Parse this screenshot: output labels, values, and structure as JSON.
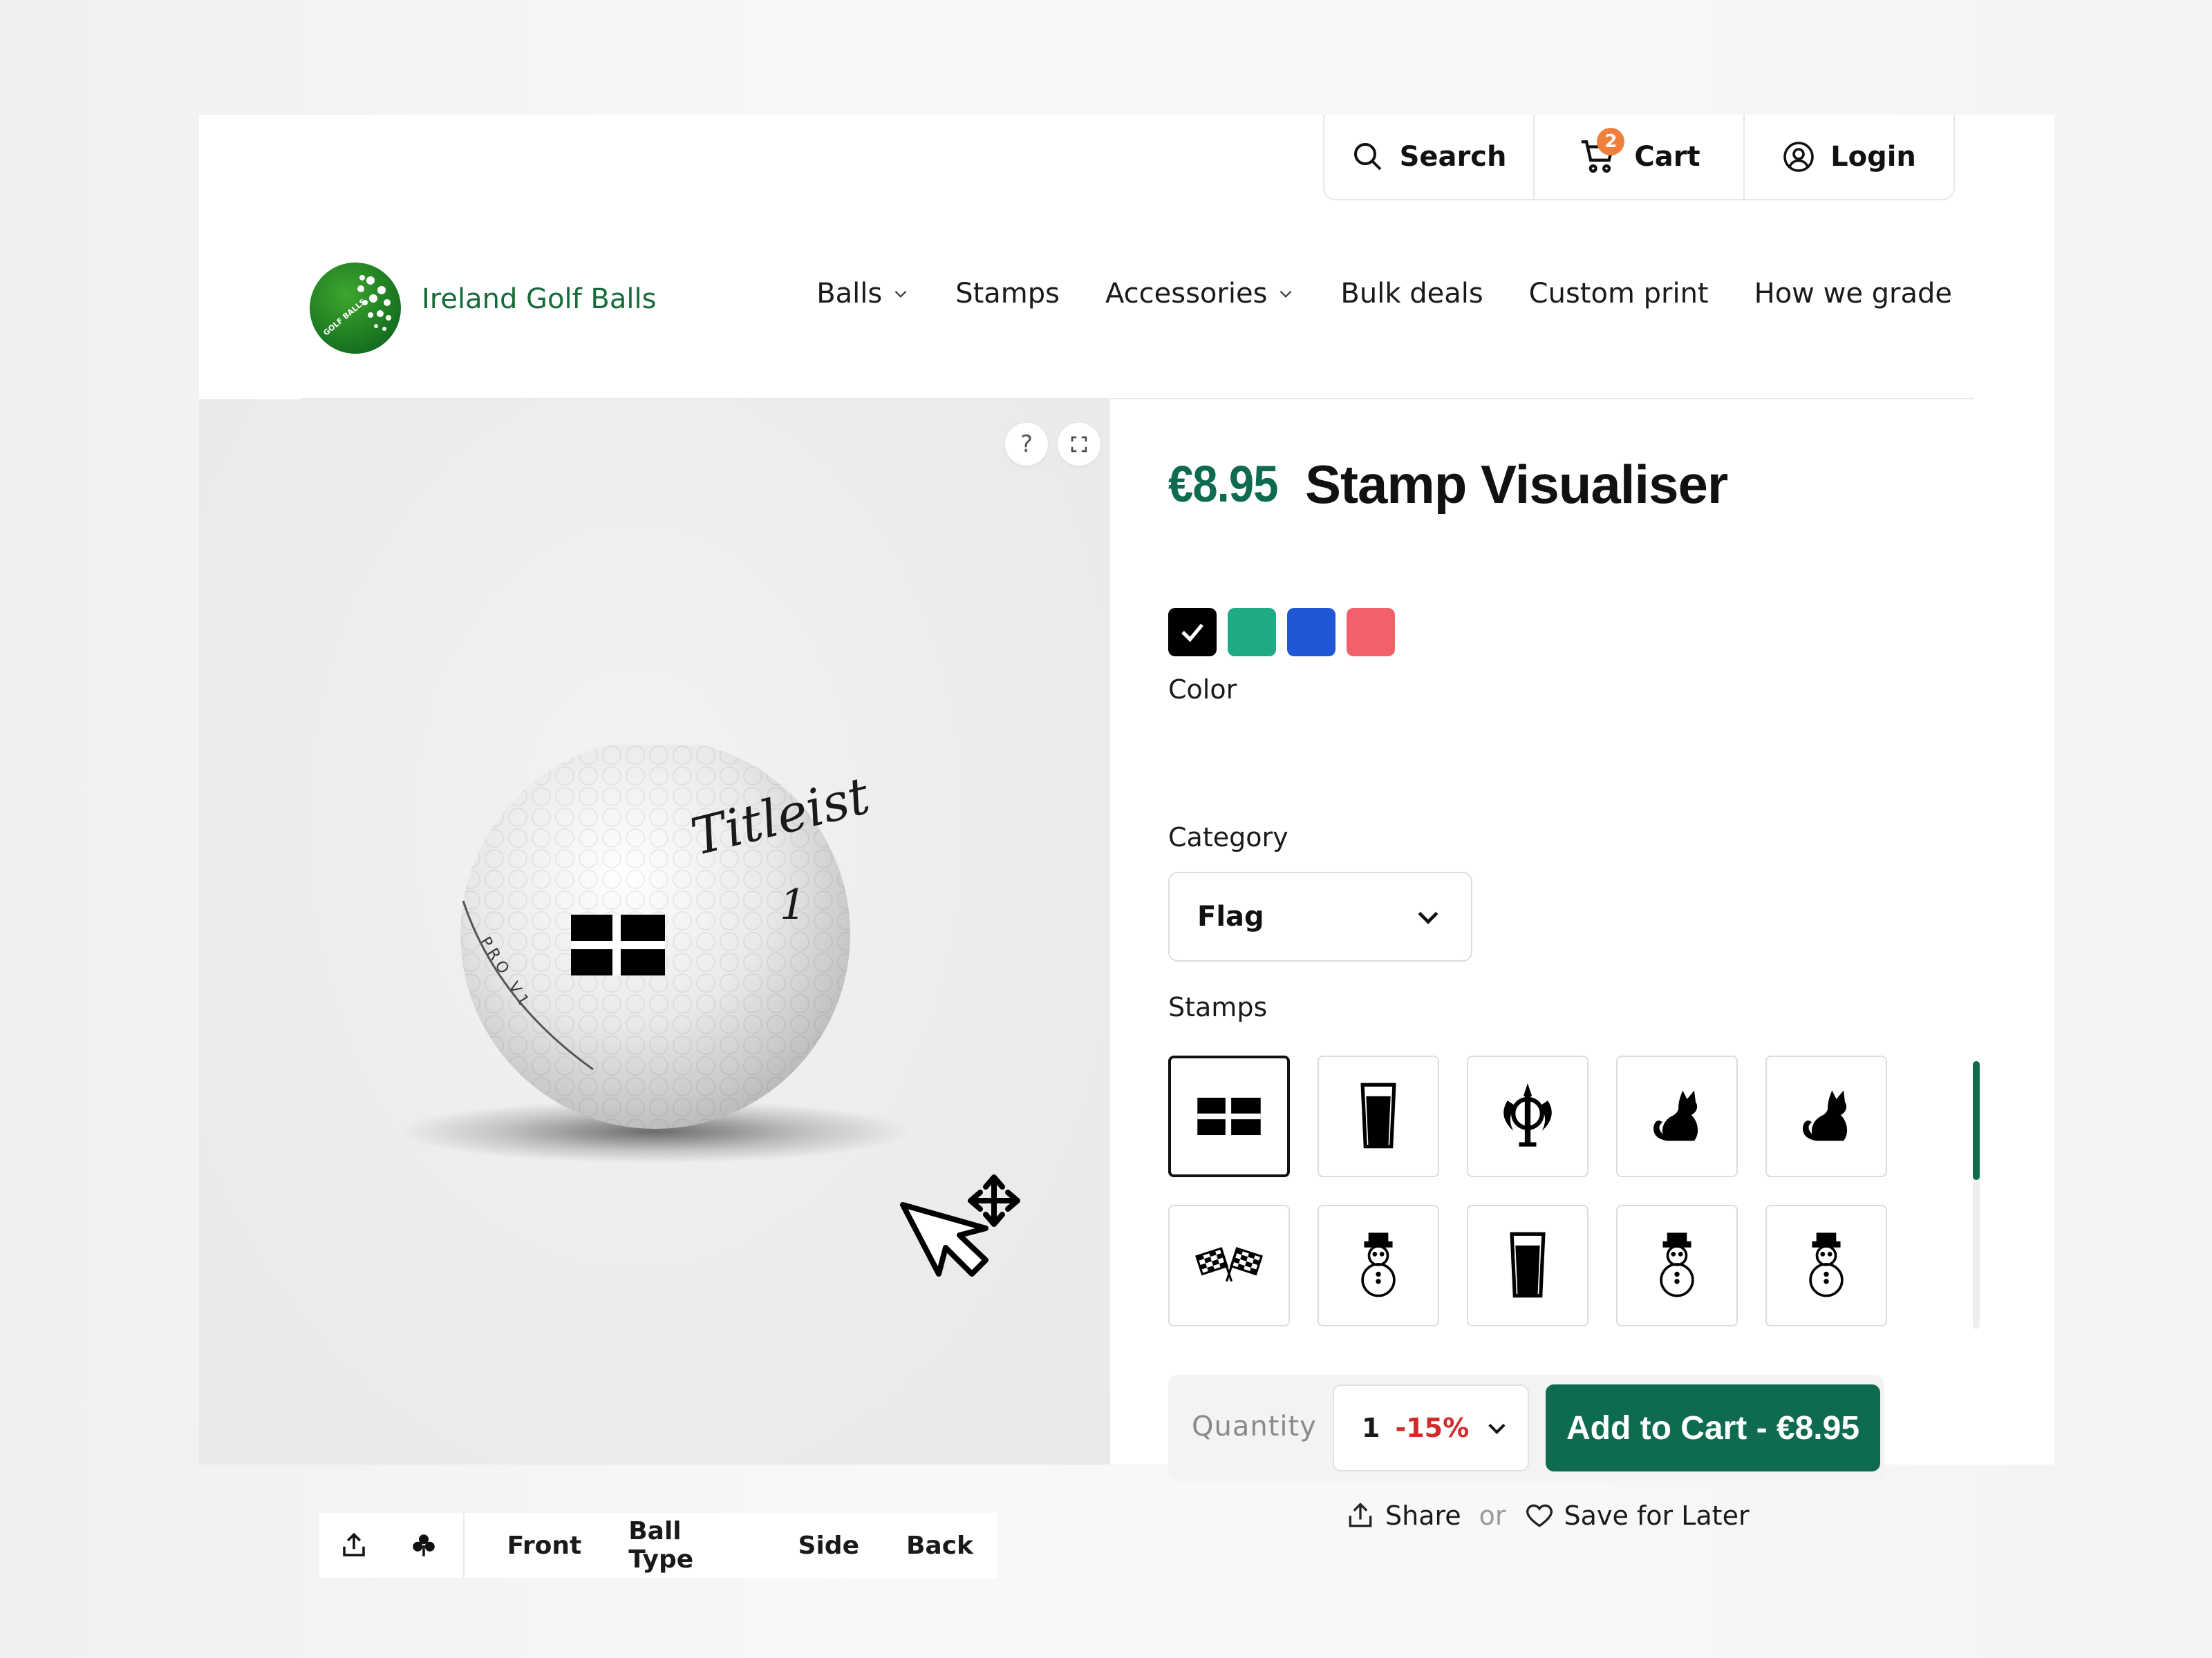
{
  "utility": {
    "search_label": "Search",
    "cart_label": "Cart",
    "cart_count": "2",
    "login_label": "Login"
  },
  "header": {
    "brand": "Ireland Golf Balls",
    "nav": [
      "Balls",
      "Stamps",
      "Accessories",
      "Bulk deals",
      "Custom print",
      "How we grade"
    ]
  },
  "viewer": {
    "help_glyph": "?",
    "ball_brand": "Titleist",
    "ball_number": "1",
    "ball_model": "PRO V1",
    "tabs": [
      "Front",
      "Ball Type",
      "Side",
      "Back"
    ]
  },
  "product": {
    "price": "€8.95",
    "title": "Stamp Visualiser",
    "color_label": "Color",
    "colors": [
      "#000000",
      "#1faa85",
      "#1f57d6",
      "#f2606a"
    ],
    "selected_color": "#000000",
    "category_label": "Category",
    "category_value": "Flag",
    "stamps_label": "Stamps",
    "stamps": [
      "flag-cross-icon",
      "pint-glass-icon",
      "khanda-icon",
      "cat-icon",
      "cat-icon",
      "checkered-flags-icon",
      "snowman-icon",
      "pint-glass-icon",
      "snowman-icon",
      "snowman-icon"
    ],
    "quantity_label": "Quantity",
    "quantity_value": "1",
    "quantity_discount": "-15%",
    "add_to_cart": "Add to Cart - €8.95",
    "share_label": "Share",
    "or_label": "or",
    "save_label": "Save for Later",
    "accent_color": "#0e6b50"
  }
}
